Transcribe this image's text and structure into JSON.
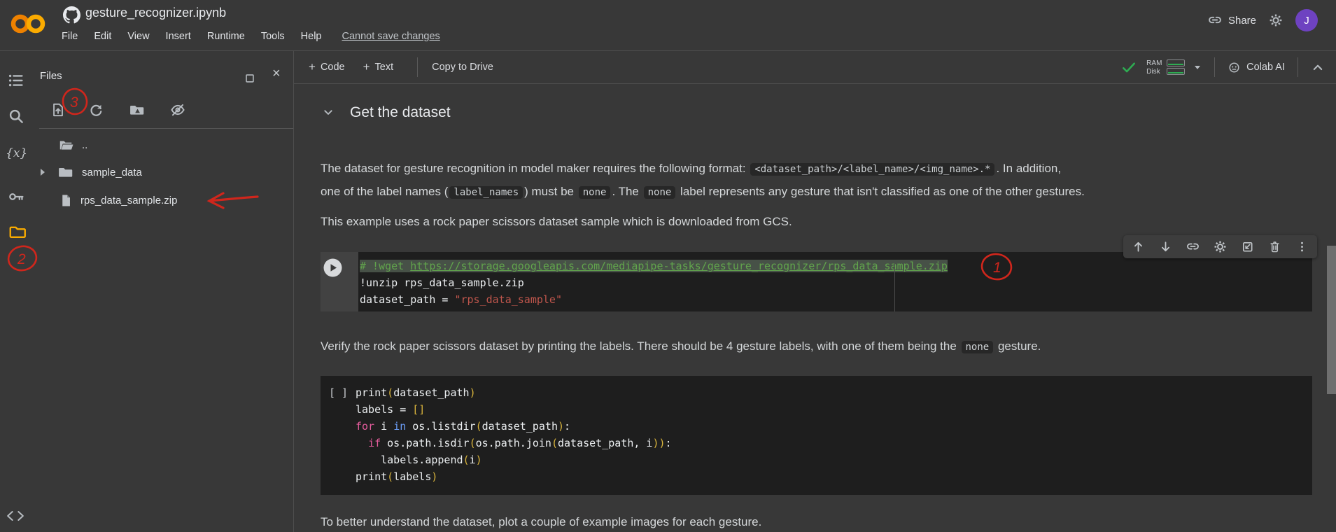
{
  "colors": {
    "red": "#d0261c",
    "purple": "#6e42c1",
    "green": "#2eac52",
    "orange": "#f9ab00"
  },
  "topbar": {
    "title": "gesture_recognizer.ipynb",
    "menus": [
      "File",
      "Edit",
      "View",
      "Insert",
      "Runtime",
      "Tools",
      "Help"
    ],
    "cannot_save": "Cannot save changes",
    "share": "Share",
    "avatar": "J"
  },
  "sidebar": {
    "title": "Files",
    "tree": [
      {
        "name": ".."
      },
      {
        "name": "sample_data"
      },
      {
        "name": "rps_data_sample.zip"
      }
    ]
  },
  "toolbar": {
    "add_code": "Code",
    "add_text": "Text",
    "plus": "+",
    "copy_to_drive": "Copy to Drive",
    "ram": "RAM",
    "disk": "Disk",
    "colab_ai": "Colab AI"
  },
  "notebook": {
    "section_title": "Get the dataset",
    "p1": [
      {
        "t": "The dataset for gesture recognition in model maker requires the following format: "
      },
      {
        "t": "<dataset_path>/<label_name>/<img_name>.*",
        "chip": true
      },
      {
        "t": ". In addition,"
      },
      {
        "br": true
      },
      {
        "t": "one of the label names ("
      },
      {
        "t": "label_names",
        "chip": true
      },
      {
        "t": ") must be "
      },
      {
        "t": "none",
        "chip": true
      },
      {
        "t": ". The "
      },
      {
        "t": "none",
        "chip": true
      },
      {
        "t": " label represents any gesture that isn't classified as one of the other gestures."
      }
    ],
    "p2": "This example uses a rock paper scissors dataset sample which is downloaded from GCS.",
    "p3": [
      {
        "t": "Verify the rock paper scissors dataset by printing the labels. There should be 4 gesture labels, with one of them being the "
      },
      {
        "t": "none",
        "chip": true
      },
      {
        "t": " gesture."
      }
    ],
    "p4": "To better understand the dataset, plot a couple of example images for each gesture.",
    "cell1_lines": [
      {
        "sel": true,
        "tk": [
          {
            "t": "# !wget ",
            "c": "com"
          },
          {
            "t": "https://storage.googleapis.com/mediapipe-tasks/gesture_recognizer/rps_data_sample.zip",
            "c": "com url"
          }
        ]
      },
      {
        "tk": [
          {
            "t": "!unzip rps_data_sample.zip",
            "c": "pln"
          }
        ]
      },
      {
        "tk": [
          {
            "t": "dataset_path = ",
            "c": "pln"
          },
          {
            "t": "\"rps_data_sample\"",
            "c": "str"
          }
        ]
      }
    ],
    "cell2_gutter": "[ ]",
    "cell2_lines": [
      {
        "tk": [
          {
            "t": "print",
            "c": "pln"
          },
          {
            "t": "(",
            "c": "brk"
          },
          {
            "t": "dataset_path",
            "c": "pln"
          },
          {
            "t": ")",
            "c": "brk"
          }
        ]
      },
      {
        "tk": [
          {
            "t": "labels = ",
            "c": "pln"
          },
          {
            "t": "[]",
            "c": "brk"
          }
        ]
      },
      {
        "tk": [
          {
            "t": "for",
            "c": "kw"
          },
          {
            "t": " i ",
            "c": "pln"
          },
          {
            "t": "in",
            "c": "kw2"
          },
          {
            "t": " os.listdir",
            "c": "pln"
          },
          {
            "t": "(",
            "c": "brk"
          },
          {
            "t": "dataset_path",
            "c": "pln"
          },
          {
            "t": ")",
            "c": "brk"
          },
          {
            "t": ":",
            "c": "pln"
          }
        ]
      },
      {
        "tk": [
          {
            "t": "  ",
            "c": "pln"
          },
          {
            "t": "if",
            "c": "kw"
          },
          {
            "t": " os.path.isdir",
            "c": "pln"
          },
          {
            "t": "(",
            "c": "brk"
          },
          {
            "t": "os.path.join",
            "c": "pln"
          },
          {
            "t": "(",
            "c": "brk"
          },
          {
            "t": "dataset_path, i",
            "c": "pln"
          },
          {
            "t": "))",
            "c": "brk"
          },
          {
            "t": ":",
            "c": "pln"
          }
        ]
      },
      {
        "tk": [
          {
            "t": "    labels.append",
            "c": "pln"
          },
          {
            "t": "(",
            "c": "brk"
          },
          {
            "t": "i",
            "c": "pln"
          },
          {
            "t": ")",
            "c": "brk"
          }
        ]
      },
      {
        "tk": [
          {
            "t": "print",
            "c": "pln"
          },
          {
            "t": "(",
            "c": "brk"
          },
          {
            "t": "labels",
            "c": "pln"
          },
          {
            "t": ")",
            "c": "brk"
          }
        ]
      }
    ]
  },
  "annotations": {
    "one": "1",
    "two": "2",
    "three": "3"
  }
}
